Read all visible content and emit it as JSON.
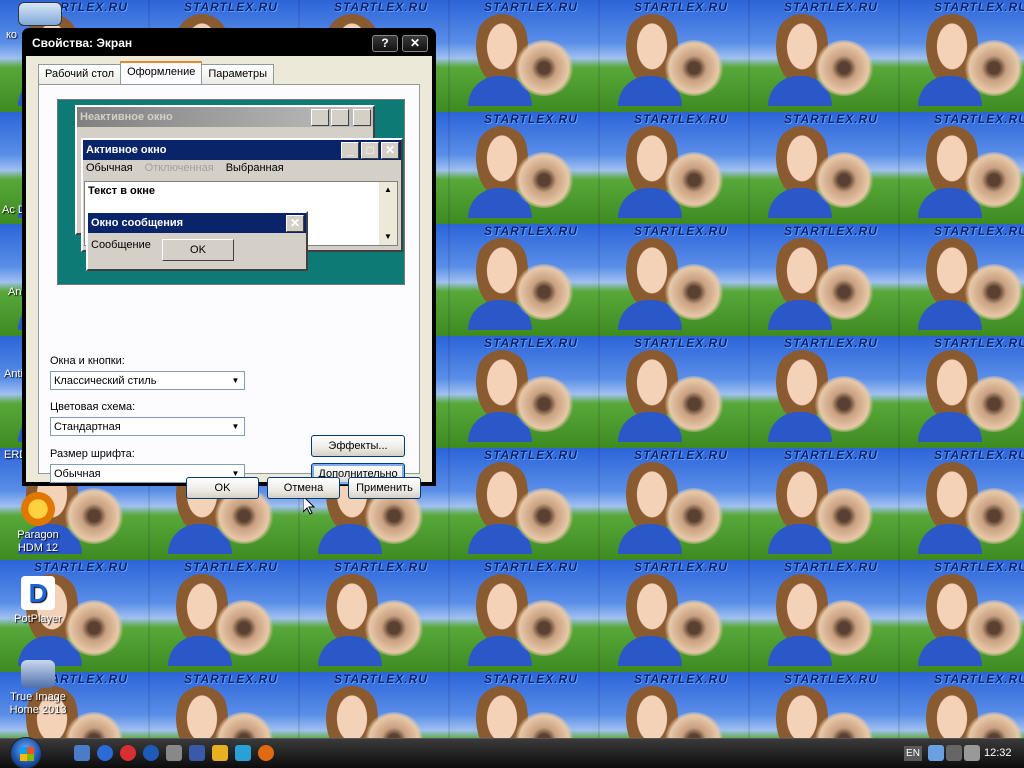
{
  "wallpaper": {
    "watermark": "STARTLEX.RU"
  },
  "desktop_icons": [
    {
      "label": "Paragon HDM 12"
    },
    {
      "label": "PotPlayer"
    },
    {
      "label": "True Image Home 2013"
    },
    {
      "label": "ERD"
    },
    {
      "label": "Ac Di"
    },
    {
      "label": "An"
    },
    {
      "label": "Anti"
    },
    {
      "label": "ко"
    }
  ],
  "dialog": {
    "title": "Свойства: Экран",
    "help_glyph": "?",
    "close_glyph": "✕",
    "tabs": [
      "Рабочий стол",
      "Оформление",
      "Параметры"
    ],
    "active_tab": "Оформление",
    "preview": {
      "inactive_title": "Неактивное окно",
      "active_title": "Активное окно",
      "menu": [
        "Обычная",
        "Отключенная",
        "Выбранная"
      ],
      "window_text": "Текст в окне",
      "msg_title": "Окно сообщения",
      "msg_text": "Сообщение",
      "msg_ok": "OK",
      "min_glyph": "_",
      "max_glyph": "□",
      "close_glyph": "✕"
    },
    "windows_buttons_label": "Окна и кнопки:",
    "windows_buttons_value": "Классический стиль",
    "color_scheme_label": "Цветовая схема:",
    "color_scheme_value": "Стандартная",
    "font_size_label": "Размер шрифта:",
    "font_size_value": "Обычная",
    "effects_button": "Эффекты...",
    "advanced_button": "Дополнительно",
    "ok_button": "OK",
    "cancel_button": "Отмена",
    "apply_button": "Применить",
    "dropdown_glyph": "▼"
  },
  "taskbar": {
    "lang": "EN",
    "clock": "12:32"
  },
  "colors": {
    "accent_titlebar": "#0a246a",
    "desktop_teal": "#0d7a76"
  }
}
